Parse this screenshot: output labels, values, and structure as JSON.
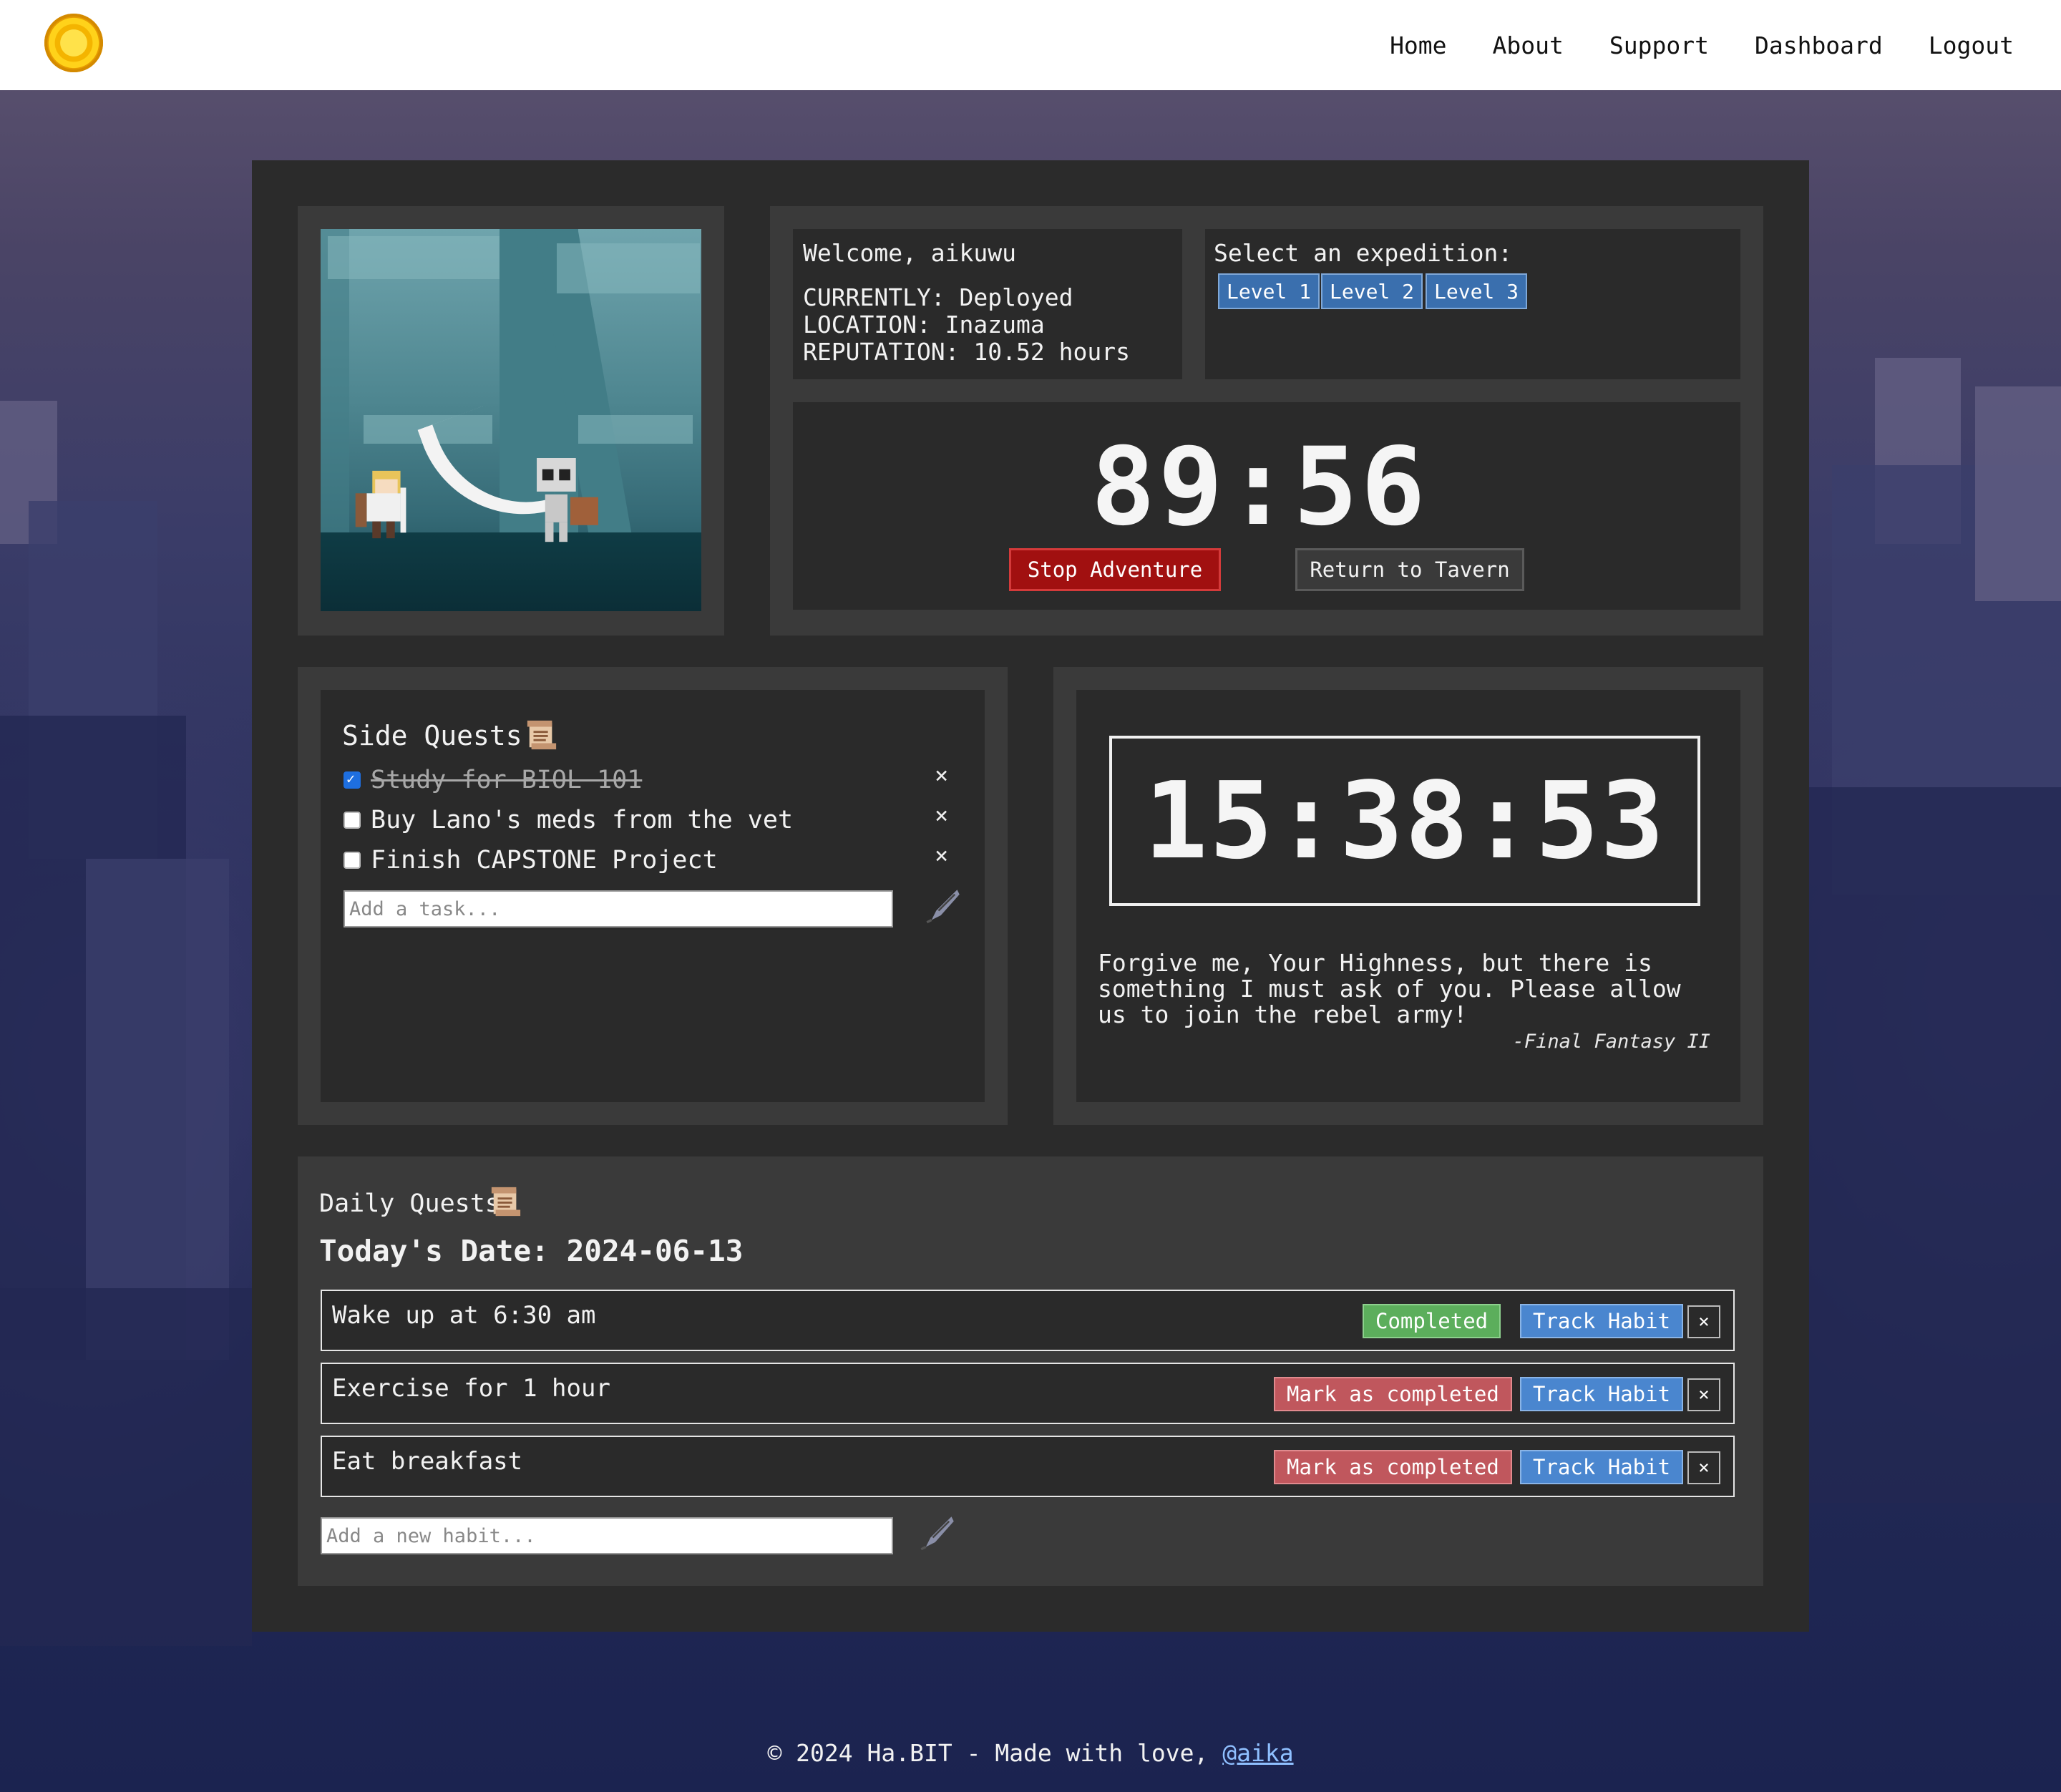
{
  "nav": {
    "links": [
      "Home",
      "About",
      "Support",
      "Dashboard",
      "Logout"
    ]
  },
  "status": {
    "welcome": "Welcome, aikuwu",
    "currently": "CURRENTLY: Deployed",
    "location": "LOCATION: Inazuma",
    "reputation": "REPUTATION: 10.52 hours"
  },
  "expedition": {
    "title": "Select an expedition:",
    "levels": [
      "Level 1",
      "Level 2",
      "Level 3"
    ]
  },
  "adventure": {
    "timer": "89:56",
    "stop_label": "Stop Adventure",
    "return_label": "Return to Tavern"
  },
  "side_quests": {
    "title": "Side Quests",
    "tasks": [
      {
        "label": "Study for BIOL 101",
        "done": true
      },
      {
        "label": "Buy Lano's meds from the vet",
        "done": false
      },
      {
        "label": "Finish CAPSTONE Project",
        "done": false
      }
    ],
    "delete_glyph": "×",
    "input_placeholder": "Add a task..."
  },
  "clock": {
    "time": "15:38:53",
    "quote": "Forgive me, Your Highness, but there is something I must ask of you. Please allow us to join the rebel army!",
    "source": "-Final Fantasy II"
  },
  "daily_quests": {
    "title": "Daily Quests",
    "date_label": "Today's Date: 2024-06-13",
    "habits": [
      {
        "label": "Wake up at 6:30 am",
        "status_label": "Completed",
        "track_label": "Track Habit",
        "delete_label": "×"
      },
      {
        "label": "Exercise for 1 hour",
        "status_label": "Mark as completed",
        "track_label": "Track Habit",
        "delete_label": "×"
      },
      {
        "label": "Eat breakfast",
        "status_label": "Mark as completed",
        "track_label": "Track Habit",
        "delete_label": "×"
      }
    ],
    "input_placeholder": "Add a new habit..."
  },
  "footer": {
    "text": "© 2024 Ha.BIT - Made with love,",
    "link": "@aika"
  },
  "colors": {
    "accent_blue": "#3a6fae",
    "stop_red": "#a11010",
    "completed_green": "#5cae5c",
    "mark_red": "#c0575d",
    "panel": "#2b2b2b"
  },
  "icons": [
    "coin-logo-icon",
    "scroll-icon",
    "quill-icon",
    "checkbox-icon",
    "close-icon"
  ]
}
